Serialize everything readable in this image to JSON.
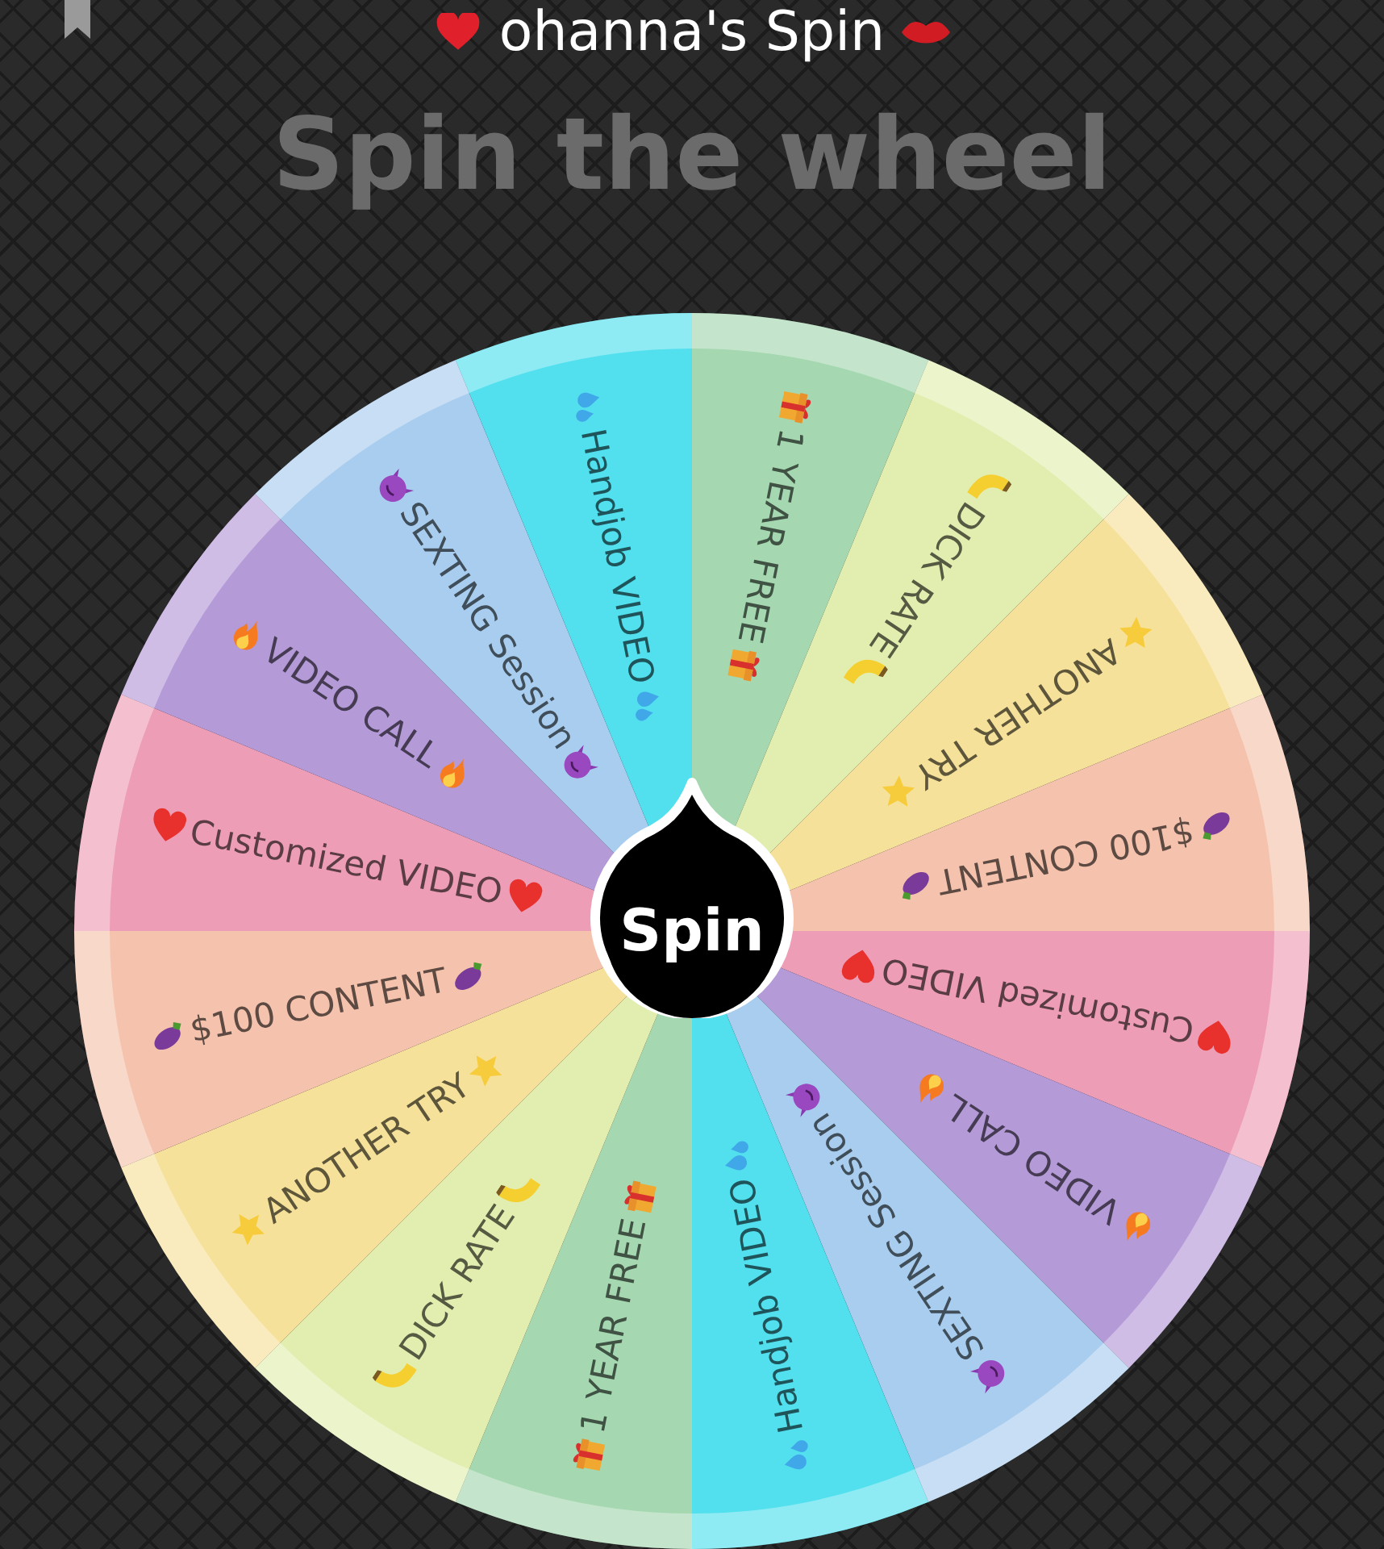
{
  "title": {
    "text": "ohanna's Spin"
  },
  "heading": "Spin the wheel",
  "wheel": {
    "segments": [
      {
        "label": "1 YEAR FREE",
        "color": "#a5d8b0"
      },
      {
        "label": "DICK RATE",
        "color": "#e2eeb0"
      },
      {
        "label": "ANOTHER TRY",
        "color": "#f6e19a"
      },
      {
        "label": "$100 CONTENT",
        "color": "#f5c3ad"
      },
      {
        "label": "Customized VIDEO",
        "color": "#ee9db6"
      },
      {
        "label": "VIDEO CALL",
        "color": "#b59ad8"
      },
      {
        "label": "SEXTING Session",
        "color": "#a9cdee"
      },
      {
        "label": "Handjob VIDEO",
        "color": "#52e0ee"
      },
      {
        "label": "1 YEAR FREE",
        "color": "#a5d8b0"
      },
      {
        "label": "DICK RATE",
        "color": "#e2eeb0"
      },
      {
        "label": "ANOTHER TRY",
        "color": "#f6e19a"
      },
      {
        "label": "$100 CONTENT",
        "color": "#f5c3ad"
      },
      {
        "label": "Customized VIDEO",
        "color": "#ee9db6"
      },
      {
        "label": "VIDEO CALL",
        "color": "#b59ad8"
      },
      {
        "label": "SEXTING Session",
        "color": "#a9cdee"
      },
      {
        "label": "Handjob VIDEO",
        "color": "#52e0ee"
      }
    ],
    "spin_button": "Spin"
  }
}
